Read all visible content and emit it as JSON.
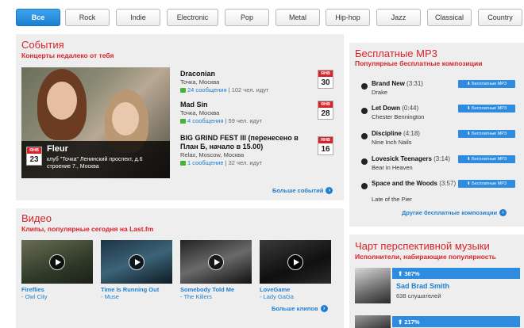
{
  "genres": [
    "Все",
    "Rock",
    "Indie",
    "Electronic",
    "Pop",
    "Metal",
    "Hip-hop",
    "Jazz",
    "Classical",
    "Country"
  ],
  "events": {
    "title": "События",
    "subtitle": "Концерты недалеко от тебя",
    "featured": {
      "month": "ЯНВ",
      "day": "23",
      "name": "Fleur",
      "venue": "клуб \"Точка\" Ленинский проспект, д.6 строение 7., Москва"
    },
    "items": [
      {
        "title": "Draconian",
        "venue": "Точка, Москва",
        "comments": "24 сообщения",
        "attendees": "| 102 чел. идут",
        "month": "ЯНВ",
        "day": "30"
      },
      {
        "title": "Mad Sin",
        "venue": "Точка, Москва",
        "comments": "4 сообщения",
        "attendees": "| 59 чел. идут",
        "month": "ЯНВ",
        "day": "28"
      },
      {
        "title": "BIG GRIND FEST III (перенесено в План Б, начало в 15.00)",
        "venue": "Relax, Moscow, Москва",
        "comments": "1 сообщение",
        "attendees": "| 32 чел. идут",
        "month": "ЯНВ",
        "day": "16"
      }
    ],
    "more": "Больше событий"
  },
  "videos": {
    "title": "Видео",
    "subtitle": "Клипы, популярные сегодня на Last.fm",
    "items": [
      {
        "title": "Fireflies",
        "artist": "- Owl City"
      },
      {
        "title": "Time Is Running Out",
        "artist": "- Muse"
      },
      {
        "title": "Somebody Told Me",
        "artist": "- The Killers"
      },
      {
        "title": "LoveGame",
        "artist": "- Lady GaGa"
      }
    ],
    "more": "Больше клипов"
  },
  "mp3": {
    "title": "Бесплатные MP3",
    "subtitle": "Популярные бесплатные композиции",
    "button_label": "⬇ Бесплатные MP3",
    "items": [
      {
        "title": "Brand New",
        "duration": "(3:31)",
        "artist": "Drake"
      },
      {
        "title": "Let Down",
        "duration": "(0:44)",
        "artist": "Chester Bennington"
      },
      {
        "title": "Discipline",
        "duration": "(4:18)",
        "artist": "Nine Inch Nails"
      },
      {
        "title": "Lovesick Teenagers",
        "duration": "(3:14)",
        "artist": "Bear in Heaven"
      },
      {
        "title": "Space and the Woods",
        "duration": "(3:57)",
        "artist": "Late of the Pier"
      }
    ],
    "more": "Другие бесплатные композиции"
  },
  "chart": {
    "title": "Чарт перспективной музыки",
    "subtitle": "Исполнители, набирающие популярность",
    "items": [
      {
        "growth": "⬆ 387%",
        "name": "Sad Brad Smith",
        "listeners": "638 слушателей"
      },
      {
        "growth": "⬆ 217%"
      }
    ]
  },
  "colors": {
    "accent_red": "#d8232a",
    "link_blue": "#1e7fd0",
    "panel_bg": "#eeeeee"
  }
}
